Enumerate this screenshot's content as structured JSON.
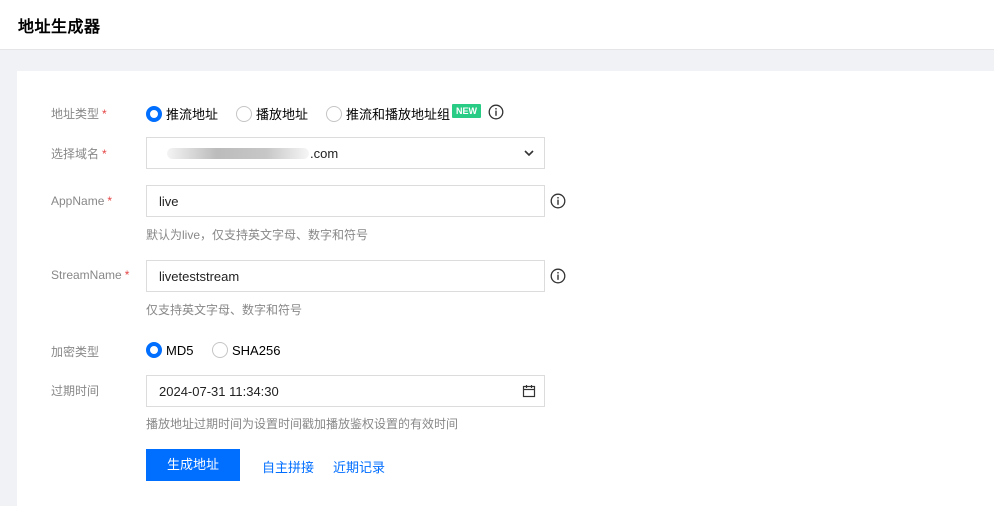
{
  "page": {
    "title": "地址生成器"
  },
  "address_type": {
    "label": "地址类型",
    "required_mark": "*",
    "options": [
      {
        "label": "推流地址",
        "selected": true
      },
      {
        "label": "播放地址",
        "selected": false
      },
      {
        "label": "推流和播放地址组",
        "selected": false
      }
    ],
    "new_badge": "NEW",
    "info_icon": "info-circle-icon"
  },
  "domain": {
    "label": "选择域名",
    "required_mark": "*",
    "value_suffix": ".com",
    "dropdown_icon": "chevron-down-icon"
  },
  "app_name": {
    "label": "AppName",
    "required_mark": "*",
    "value": "live",
    "help": "默认为live，仅支持英文字母、数字和符号",
    "info_icon": "info-circle-icon"
  },
  "stream_name": {
    "label": "StreamName",
    "required_mark": "*",
    "value": "liveteststream",
    "help": "仅支持英文字母、数字和符号",
    "info_icon": "info-circle-icon"
  },
  "encryption": {
    "label": "加密类型",
    "options": [
      {
        "label": "MD5",
        "selected": true
      },
      {
        "label": "SHA256",
        "selected": false
      }
    ]
  },
  "expiry": {
    "label": "过期时间",
    "value": "2024-07-31 11:34:30",
    "help": "播放地址过期时间为设置时间戳加播放鉴权设置的有效时间",
    "calendar_icon": "calendar-icon"
  },
  "actions": {
    "generate": "生成地址",
    "custom_compose": "自主拼接",
    "recent_records": "近期记录"
  },
  "colors": {
    "primary": "#006eff",
    "required": "#e54545",
    "badge": "#29cc85"
  }
}
